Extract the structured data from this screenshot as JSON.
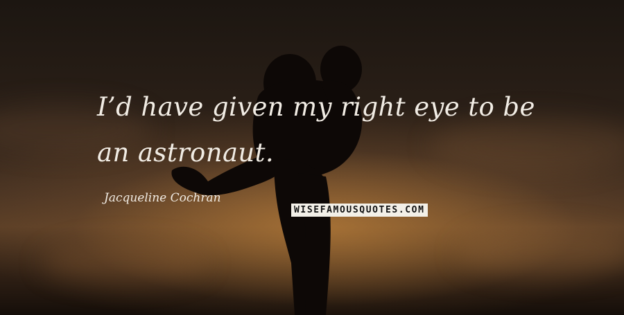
{
  "quote": {
    "text": "I’d have given my right eye to be an astronaut."
  },
  "author": {
    "name": "Jacqueline Cochran"
  },
  "watermark": {
    "text": "WISEFAMOUSQUOTES.COM"
  },
  "colors": {
    "text": "#f1ece4",
    "sky_glow": "#cd8c3c",
    "silhouette": "#0d0806"
  }
}
